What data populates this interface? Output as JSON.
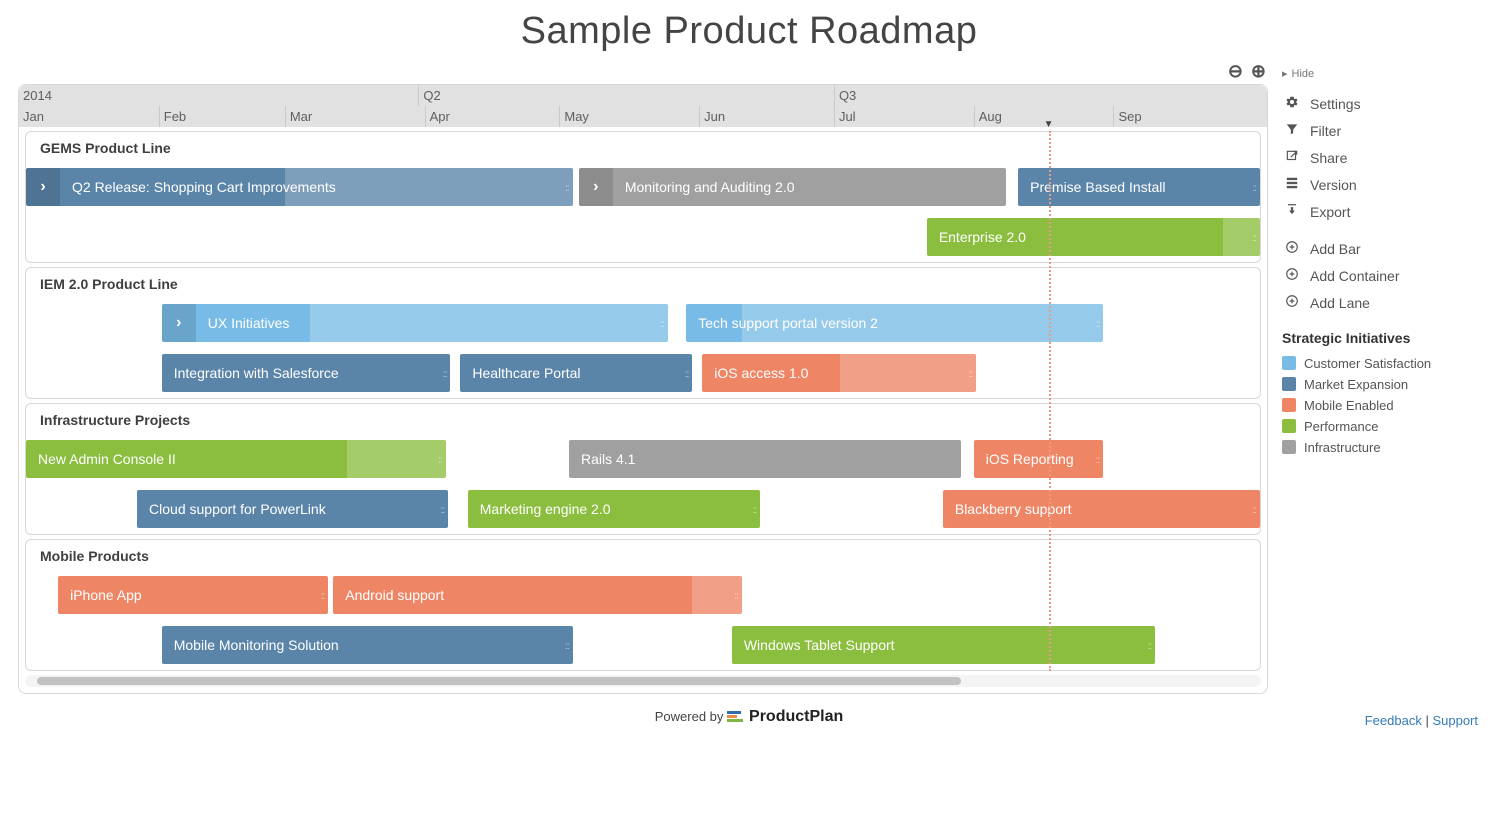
{
  "title": "Sample Product Roadmap",
  "footer": {
    "powered_by": "Powered by",
    "brand": "ProductPlan",
    "feedback": "Feedback",
    "support": "Support"
  },
  "timeline": {
    "year": "2014",
    "quarters": [
      {
        "label": "Q2",
        "pos": 32.0
      },
      {
        "label": "Q3",
        "pos": 65.3
      }
    ],
    "months": [
      {
        "label": "Jan",
        "pos": 0.0
      },
      {
        "label": "Feb",
        "pos": 11.2
      },
      {
        "label": "Mar",
        "pos": 21.3
      },
      {
        "label": "Apr",
        "pos": 32.5
      },
      {
        "label": "May",
        "pos": 43.3
      },
      {
        "label": "Jun",
        "pos": 54.5
      },
      {
        "label": "Jul",
        "pos": 65.3
      },
      {
        "label": "Aug",
        "pos": 76.5
      },
      {
        "label": "Sep",
        "pos": 87.7
      }
    ],
    "today_pos": 82.5
  },
  "colors": {
    "customer_satisfaction": "#78bbe6",
    "market_expansion": "#5a84a8",
    "mobile_enabled": "#ee8666",
    "performance": "#8bbe3f",
    "infrastructure": "#a0a0a0"
  },
  "sidebar": {
    "hide": "Hide",
    "menu": [
      {
        "icon": "gear",
        "label": "Settings"
      },
      {
        "icon": "filter",
        "label": "Filter"
      },
      {
        "icon": "share",
        "label": "Share"
      },
      {
        "icon": "version",
        "label": "Version"
      },
      {
        "icon": "export",
        "label": "Export"
      }
    ],
    "add": [
      {
        "label": "Add Bar"
      },
      {
        "label": "Add Container"
      },
      {
        "label": "Add Lane"
      }
    ],
    "legend_title": "Strategic Initiatives",
    "legend": [
      {
        "label": "Customer Satisfaction",
        "color": "customer_satisfaction"
      },
      {
        "label": "Market Expansion",
        "color": "market_expansion"
      },
      {
        "label": "Mobile Enabled",
        "color": "mobile_enabled"
      },
      {
        "label": "Performance",
        "color": "performance"
      },
      {
        "label": "Infrastructure",
        "color": "infrastructure"
      }
    ]
  },
  "lanes": [
    {
      "title": "GEMS Product Line",
      "rows": [
        [
          {
            "label": "Q2 Release: Shopping Cart Improvements",
            "start": 0,
            "end": 44.3,
            "color": "market_expansion",
            "chevron": true,
            "shade_from": 21,
            "handle": true
          },
          {
            "label": "Monitoring and Auditing 2.0",
            "start": 44.8,
            "end": 79.4,
            "color": "infrastructure",
            "chevron": true
          },
          {
            "label": "Premise Based Install",
            "start": 80.4,
            "end": 100,
            "color": "market_expansion",
            "handle": true
          }
        ],
        [
          {
            "label": "Enterprise 2.0",
            "start": 73.0,
            "end": 100,
            "color": "performance",
            "handle": true,
            "shade_from": 97
          }
        ]
      ]
    },
    {
      "title": "IEM 2.0 Product Line",
      "rows": [
        [
          {
            "label": "UX Initiatives",
            "start": 11.0,
            "end": 52.0,
            "color": "customer_satisfaction",
            "chevron": true,
            "handle": true,
            "shade_from": 23
          },
          {
            "label": "Tech support portal version 2",
            "start": 53.5,
            "end": 87.3,
            "color": "customer_satisfaction",
            "handle": true,
            "shade_from": 58
          }
        ],
        [
          {
            "label": "Integration with Salesforce",
            "start": 11.0,
            "end": 34.4,
            "color": "market_expansion",
            "handle": true
          },
          {
            "label": "Healthcare Portal",
            "start": 35.2,
            "end": 54.0,
            "color": "market_expansion",
            "handle": true
          },
          {
            "label": "iOS access 1.0",
            "start": 54.8,
            "end": 77.0,
            "color": "mobile_enabled",
            "handle": true,
            "shade_from": 66
          }
        ]
      ]
    },
    {
      "title": "Infrastructure Projects",
      "rows": [
        [
          {
            "label": "New Admin Console II",
            "start": 0,
            "end": 34.0,
            "color": "performance",
            "handle": true,
            "shade_from": 26
          },
          {
            "label": "Rails 4.1",
            "start": 44.0,
            "end": 75.8,
            "color": "infrastructure"
          },
          {
            "label": "iOS Reporting",
            "start": 76.8,
            "end": 87.3,
            "color": "mobile_enabled",
            "handle": true
          }
        ],
        [
          {
            "label": "Cloud support for PowerLink",
            "start": 9.0,
            "end": 34.2,
            "color": "market_expansion",
            "handle": true
          },
          {
            "label": "Marketing engine 2.0",
            "start": 35.8,
            "end": 59.5,
            "color": "performance",
            "handle": true
          },
          {
            "label": "Blackberry support",
            "start": 74.3,
            "end": 100,
            "color": "mobile_enabled",
            "handle": true
          }
        ]
      ]
    },
    {
      "title": "Mobile Products",
      "rows": [
        [
          {
            "label": "iPhone App",
            "start": 2.6,
            "end": 24.5,
            "color": "mobile_enabled",
            "handle": true
          },
          {
            "label": "Android support",
            "start": 24.9,
            "end": 58.0,
            "color": "mobile_enabled",
            "handle": true,
            "shade_from": 54
          }
        ],
        [
          {
            "label": "Mobile Monitoring Solution",
            "start": 11.0,
            "end": 44.3,
            "color": "market_expansion",
            "handle": true
          },
          {
            "label": "Windows Tablet Support",
            "start": 57.2,
            "end": 91.5,
            "color": "performance",
            "handle": true
          }
        ]
      ]
    }
  ]
}
